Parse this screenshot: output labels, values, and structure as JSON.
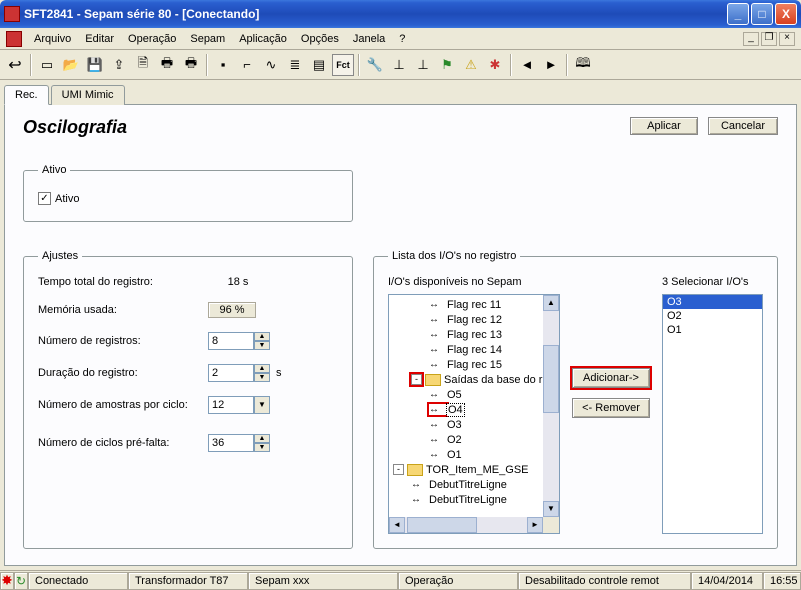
{
  "title": "SFT2841 - Sepam série 80 - [Conectando]",
  "menubar": {
    "arquivo": "Arquivo",
    "editar": "Editar",
    "operacao": "Operação",
    "sepam": "Sepam",
    "aplicacao": "Aplicação",
    "opcoes": "Opções",
    "janela": "Janela",
    "help": "?"
  },
  "toolbar_fct": "Fct",
  "tabs": {
    "rec": "Rec.",
    "umi": "UMI Mimic"
  },
  "heading": "Oscilografia",
  "buttons": {
    "aplicar": "Aplicar",
    "cancelar": "Cancelar",
    "adicionar": "Adicionar->",
    "remover": "<- Remover"
  },
  "groups": {
    "ativo_legend": "Ativo",
    "ativo_label": "Ativo",
    "ativo_checked": true,
    "ajustes_legend": "Ajustes",
    "lista_legend": "Lista dos I/O's no registro"
  },
  "ajustes": {
    "tempo_total_label": "Tempo total do registro:",
    "tempo_total_value": "18 s",
    "memoria_label": "Memória usada:",
    "memoria_value": "96 %",
    "num_registros_label": "Número de registros:",
    "num_registros_value": "8",
    "duracao_label": "Duração do registro:",
    "duracao_value": "2",
    "duracao_unit": "s",
    "amostras_label": "Número de amostras por ciclo:",
    "amostras_value": "12",
    "prefalta_label": "Número de ciclos pré-falta:",
    "prefalta_value": "36"
  },
  "lista": {
    "disp_label": "I/O's disponíveis no Sepam",
    "sel_label": "3 Selecionar I/O's",
    "tree": {
      "flag11": "Flag rec 11",
      "flag12": "Flag rec 12",
      "flag13": "Flag rec 13",
      "flag14": "Flag rec 14",
      "flag15": "Flag rec 15",
      "saidas": "Saídas da base do r",
      "o5": "O5",
      "o4": "O4",
      "o3": "O3",
      "o2": "O2",
      "o1": "O1",
      "tor": "TOR_Item_ME_GSE",
      "debut1": "DebutTitreLigne",
      "debut2": "DebutTitreLigne"
    },
    "selected": [
      "O3",
      "O2",
      "O1"
    ]
  },
  "status": {
    "conectado": "Conectado",
    "trafo": "Transformador T87",
    "sepam": "Sepam xxx",
    "oper": "Operação",
    "remoto": "Desabilitado controle remot",
    "data": "14/04/2014",
    "hora": "16:55"
  }
}
